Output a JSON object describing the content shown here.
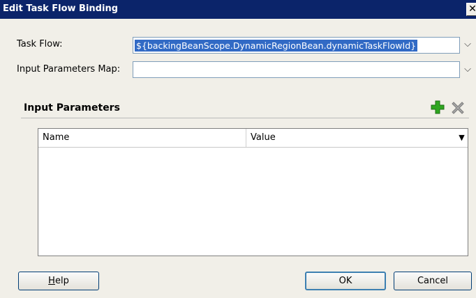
{
  "window": {
    "title": "Edit Task Flow Binding",
    "close_glyph": "✕"
  },
  "form": {
    "task_flow": {
      "label": "Task Flow:",
      "value": "${backingBeanScope.DynamicRegionBean.dynamicTaskFlowId}"
    },
    "input_parameters_map": {
      "label": "Input Parameters Map:",
      "value": ""
    },
    "dropdown_glyph": "⌵"
  },
  "input_parameters": {
    "title": "Input Parameters",
    "add_icon": "add-icon",
    "delete_icon": "delete-icon",
    "columns": [
      "Name",
      "Value"
    ],
    "rows": [],
    "column_menu_glyph": "▼"
  },
  "buttons": {
    "help": {
      "mnemonic": "H",
      "rest": "elp"
    },
    "ok": "OK",
    "cancel": "Cancel"
  },
  "colors": {
    "titlebar": "#0b246a",
    "selection": "#316ac5",
    "add_icon": "#2ea61f",
    "delete_icon": "#8c8c8c"
  }
}
